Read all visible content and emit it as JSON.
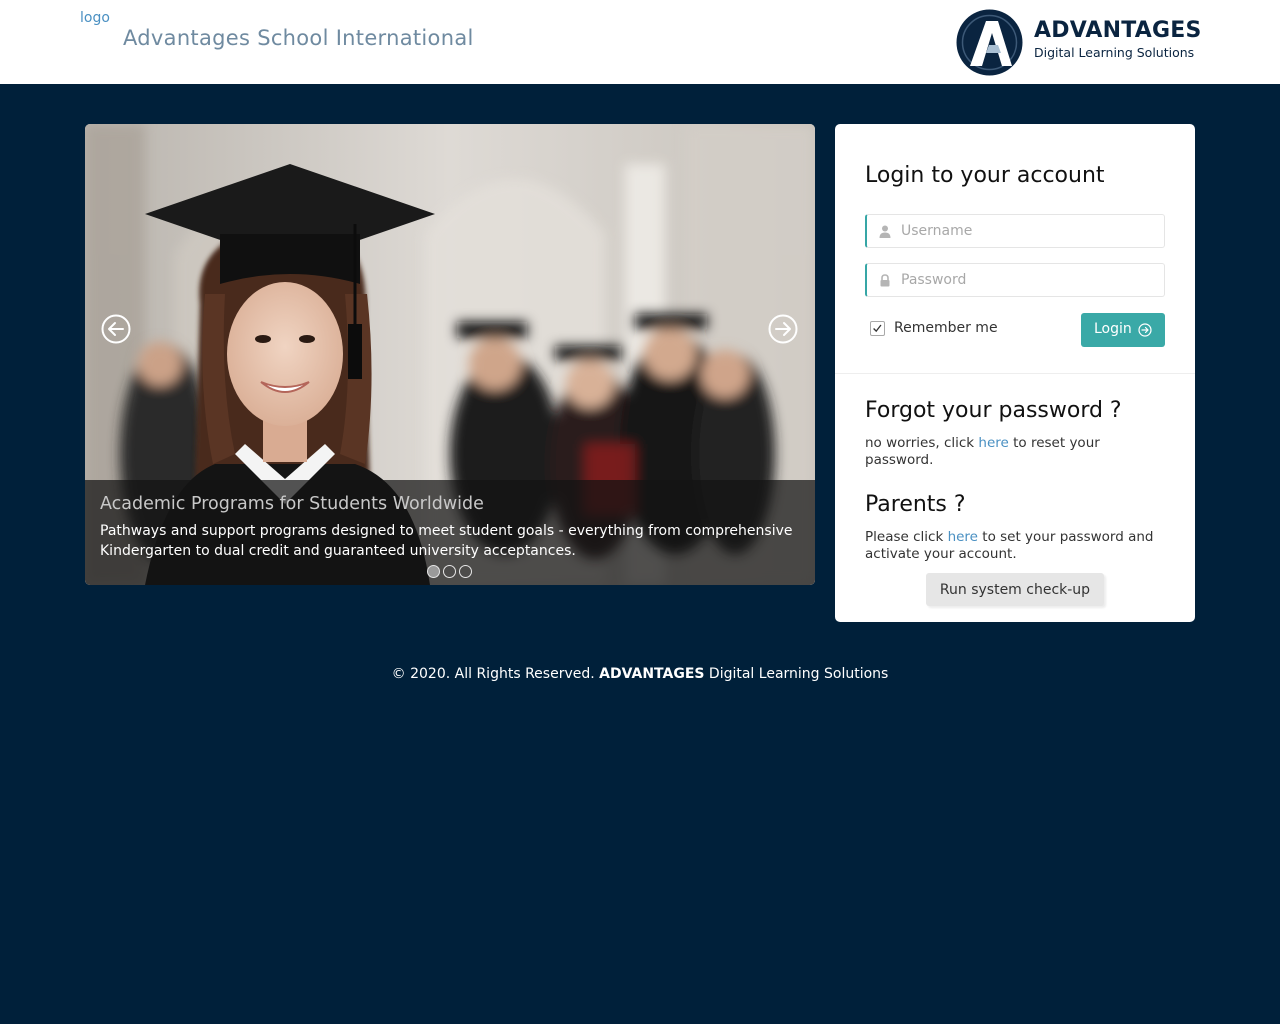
{
  "header": {
    "logo_alt": "logo",
    "school_name": "Advantages School International",
    "brand": {
      "initial": "A",
      "title": "ADVANTAGES",
      "subtitle": "Digital Learning Solutions"
    }
  },
  "carousel": {
    "prev_icon": "arrow-left-circle-icon",
    "next_icon": "arrow-right-circle-icon",
    "slides_count": 3,
    "active_slide": 1,
    "caption": {
      "title": "Academic Programs for Students Worldwide",
      "text": "Pathways and support programs designed to meet student goals - everything from comprehensive Kindergarten to dual credit and guaranteed university acceptances."
    }
  },
  "login": {
    "title": "Login to your account",
    "username_placeholder": "Username",
    "username_value": "",
    "username_icon": "user-icon",
    "password_placeholder": "Password",
    "password_value": "",
    "password_icon": "lock-icon",
    "remember_label": "Remember me",
    "remember_checked": true,
    "login_label": "Login",
    "login_icon": "arrow-right-circle-icon"
  },
  "forgot": {
    "title": "Forgot your password ?",
    "text_before": "no worries, click ",
    "link": "here",
    "text_after": " to reset your password."
  },
  "parents": {
    "title": "Parents ?",
    "text_before": "Please click ",
    "link": "here",
    "text_after": " to set your password and activate your account.",
    "checkup_label": "Run system check-up"
  },
  "footer": {
    "prefix": "© 2020. All Rights Reserved. ",
    "brand": "ADVANTAGES",
    "suffix": " Digital Learning Solutions"
  },
  "colors": {
    "page_bg": "#00203a",
    "accent_teal": "#3aa9a7",
    "link_blue": "#4a90c2",
    "brand_navy": "#0a2440"
  }
}
